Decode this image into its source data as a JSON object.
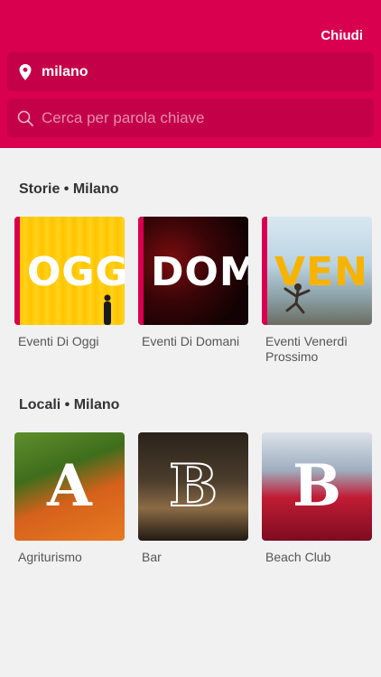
{
  "header": {
    "close_label": "Chiudi",
    "location_value": "milano",
    "search_placeholder": "Cerca per parola chiave"
  },
  "stories": {
    "title": "Storie • Milano",
    "items": [
      {
        "label": "Eventi Di Oggi",
        "image_text": "OGG",
        "icon": "oggi-image"
      },
      {
        "label": "Eventi Di Domani",
        "image_text": "DOM",
        "icon": "domani-image"
      },
      {
        "label": "Eventi Venerdì Prossimo",
        "image_text": "VEN",
        "icon": "venerdi-image"
      }
    ]
  },
  "locali": {
    "title": "Locali • Milano",
    "items": [
      {
        "label": "Agriturismo",
        "image_text": "A",
        "icon": "agriturismo-image"
      },
      {
        "label": "Bar",
        "image_text": "B",
        "icon": "bar-image"
      },
      {
        "label": "Beach Club",
        "image_text": "B",
        "icon": "beach-club-image"
      }
    ]
  },
  "colors": {
    "brand": "#d9004f",
    "field": "#c40048",
    "background": "#f1f1f2"
  }
}
